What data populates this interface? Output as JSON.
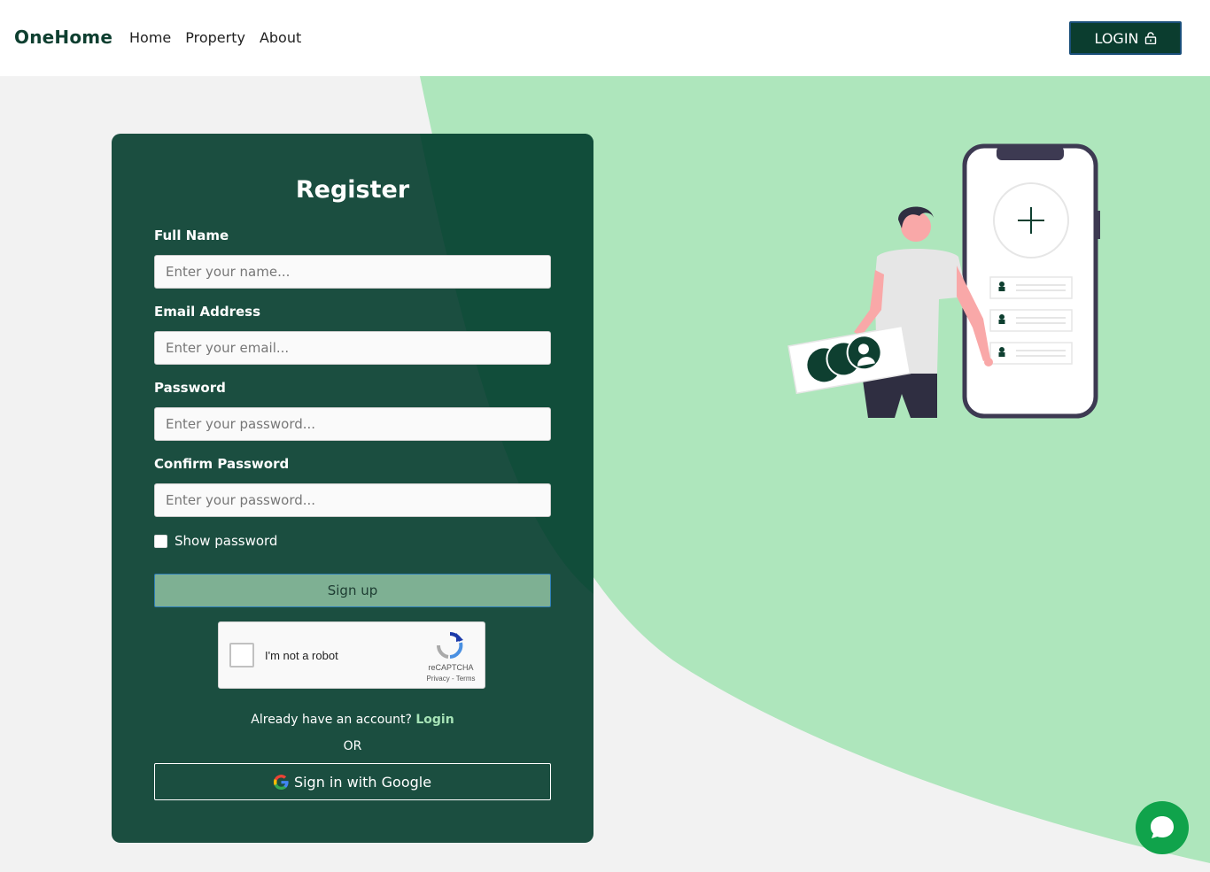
{
  "header": {
    "brand": "OneHome",
    "nav": [
      "Home",
      "Property",
      "About"
    ],
    "login_label": "LOGIN"
  },
  "form": {
    "title": "Register",
    "fields": [
      {
        "label": "Full Name",
        "placeholder": "Enter your name...",
        "value": ""
      },
      {
        "label": "Email Address",
        "placeholder": "Enter your email...",
        "value": ""
      },
      {
        "label": "Password",
        "placeholder": "Enter your password...",
        "value": ""
      },
      {
        "label": "Confirm Password",
        "placeholder": "Enter your password...",
        "value": ""
      }
    ],
    "show_password_label": "Show password",
    "show_password_checked": false,
    "signup_label": "Sign up",
    "recaptcha": {
      "label": "I'm not a robot",
      "brand": "reCAPTCHA",
      "links": "Privacy - Terms"
    },
    "already_text": "Already have an account?",
    "login_link": "Login",
    "or_text": "OR",
    "google_label": "Sign in with Google"
  },
  "colors": {
    "brand_dark": "#0e3f30",
    "card": "#1b4e40",
    "accent_light": "#aee6bc",
    "chat": "#10a34b"
  },
  "icons": {
    "login": "lock-open-icon",
    "google": "google-icon",
    "chat": "chat-bubble-icon",
    "recaptcha": "recaptcha-icon"
  }
}
